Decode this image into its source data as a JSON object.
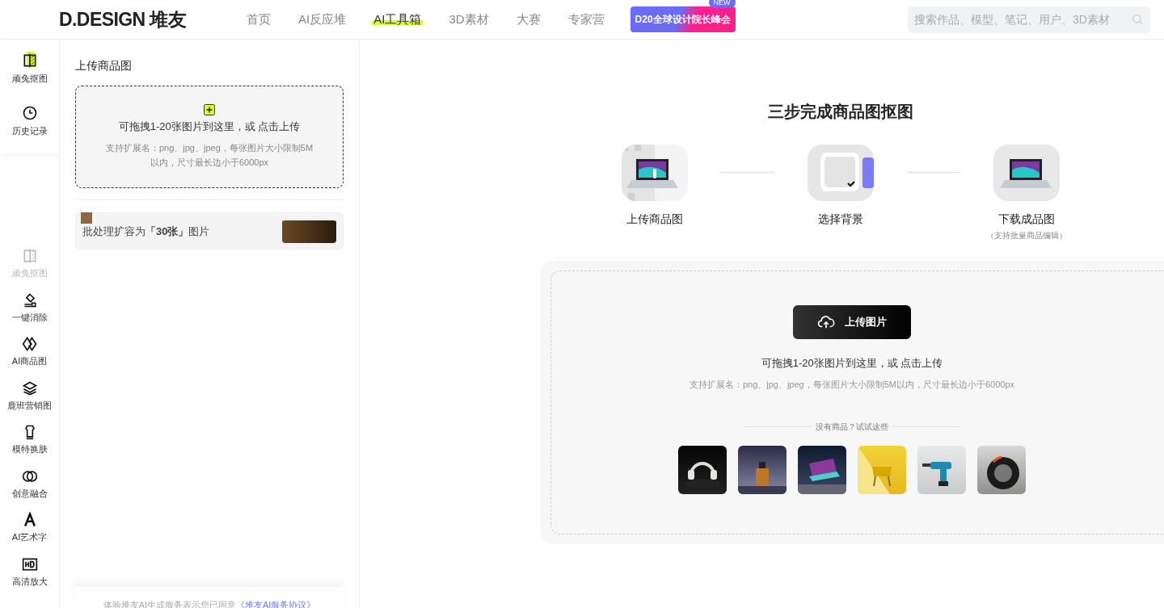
{
  "header": {
    "logo": "D.DESIGN 堆友",
    "nav": [
      {
        "label": "首页",
        "selected": false
      },
      {
        "label": "AI反应堆",
        "selected": false
      },
      {
        "label": "AI工具箱",
        "selected": true
      },
      {
        "label": "3D素材",
        "selected": false
      },
      {
        "label": "大赛",
        "selected": false
      },
      {
        "label": "专家营",
        "selected": false
      }
    ],
    "promo": {
      "label": "D20全球设计院长峰会",
      "badge": "NEW"
    },
    "search": {
      "placeholder": "搜索作品、模型、笔记、用户、3D素材"
    }
  },
  "sidebar": {
    "top": [
      {
        "label": "顽兔抠图",
        "selected": true
      },
      {
        "label": "历史记录",
        "selected": false
      }
    ],
    "tools": [
      {
        "label": "顽兔抠图",
        "disabled": true
      },
      {
        "label": "一键消除",
        "disabled": false
      },
      {
        "label": "AI商品图",
        "disabled": false
      },
      {
        "label": "鹿班营销图",
        "disabled": false
      },
      {
        "label": "模特换肤",
        "disabled": false
      },
      {
        "label": "创意融合",
        "disabled": false
      },
      {
        "label": "AI艺术字",
        "disabled": false
      },
      {
        "label": "高清放大",
        "disabled": false
      }
    ]
  },
  "panel": {
    "title": "上传商品图",
    "dropzone": {
      "main": "可拖拽1-20张图片到这里，或 点击上传",
      "hint": "支持扩展名：png、jpg、jpeg，每张图片大小限制5M以内，尺寸最长边小于6000px"
    },
    "promo": "批处理扩容为**「30张」**图片",
    "footer": {
      "text": "体验堆友AI生成服务表示您已同意",
      "link": "《堆友AI服务协议》"
    }
  },
  "main": {
    "title": "三步完成商品图抠图",
    "steps": [
      {
        "label": "上传商品图",
        "kind": "split"
      },
      {
        "label": "选择背景",
        "kind": "background"
      },
      {
        "label": "下载成品图",
        "kind": "laptop",
        "note": "（支持批量商品编辑）"
      }
    ],
    "upload": {
      "button": "上传图片",
      "main": "可拖拽1-20张图片到这里，或 点击上传",
      "hint": "支持扩展名：png、jpg、jpeg，每张图片大小限制5M以内，尺寸最长边小于6000px",
      "samples_title": "没有商品？试试这些"
    }
  }
}
